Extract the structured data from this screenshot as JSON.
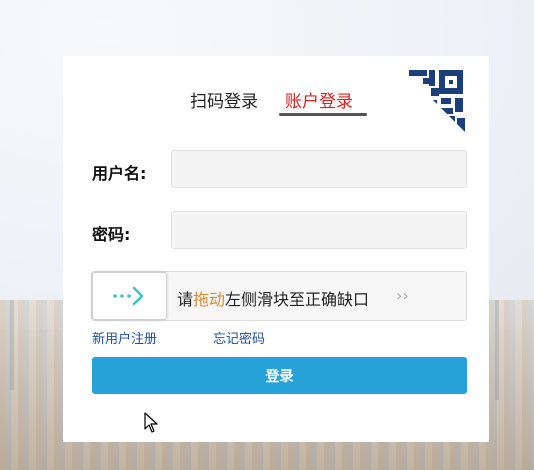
{
  "tabs": {
    "scan_label": "扫码登录",
    "account_label": "账户登录"
  },
  "form": {
    "username_label": "用户名:",
    "username_value": "",
    "password_label": "密码:",
    "password_value": ""
  },
  "slider": {
    "text_prefix": "请",
    "text_highlight": "拖动",
    "text_suffix": "左侧滑块至正确缺口",
    "chevrons": "››",
    "handle_icon": "arrow-right-dots-icon"
  },
  "links": {
    "register": "新用户注册",
    "forgot": "忘记密码"
  },
  "login_button": "登录",
  "colors": {
    "active_tab": "#e02020",
    "link": "#1f4fa6",
    "button": "#27a2d8",
    "qr_corner": "#1a3f7a",
    "slider_icon": "#3cc7c0",
    "highlight": "#e38a2c"
  }
}
